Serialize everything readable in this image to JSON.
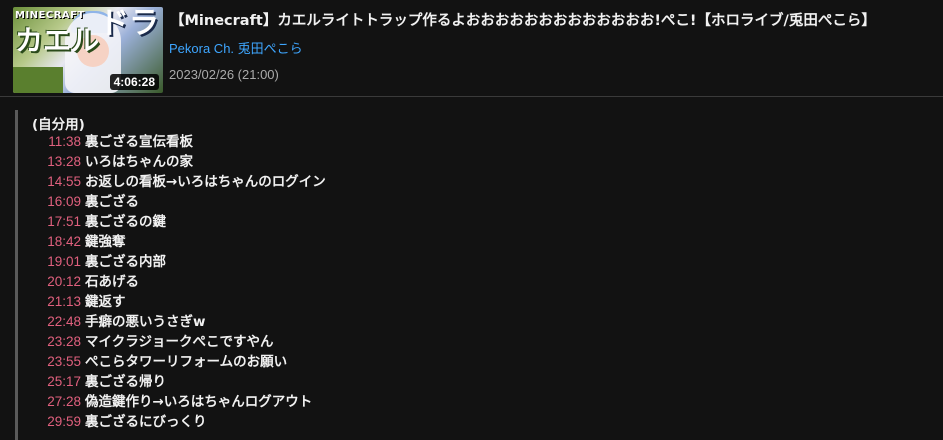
{
  "video": {
    "title": "【Minecraft】カエルライトトラップ作るよおおおおおおおおおおおおお!ぺこ!【ホロライブ/兎田ぺこら】",
    "channel": "Pekora Ch. 兎田ぺこら",
    "date": "2023/02/26 (21:00)",
    "duration": "4:06:28",
    "thumbnail_text": {
      "minecraft": "MINECRAFT",
      "left": "カエル",
      "right": "ドラ"
    }
  },
  "comment": {
    "heading": "(自分用)",
    "timestamps": [
      {
        "time": "11:38",
        "text": "裏ござる宣伝看板"
      },
      {
        "time": "13:28",
        "text": "いろはちゃんの家"
      },
      {
        "time": "14:55",
        "text": "お返しの看板→いろはちゃんのログイン"
      },
      {
        "time": "16:09",
        "text": "裏ござる"
      },
      {
        "time": "17:51",
        "text": "裏ござるの鍵"
      },
      {
        "time": "18:42",
        "text": "鍵強奪"
      },
      {
        "time": "19:01",
        "text": "裏ござる内部"
      },
      {
        "time": "20:12",
        "text": "石あげる"
      },
      {
        "time": "21:13",
        "text": "鍵返す"
      },
      {
        "time": "22:48",
        "text": "手癖の悪いうさぎw"
      },
      {
        "time": "23:28",
        "text": "マイクラジョークぺこですやん"
      },
      {
        "time": "23:55",
        "text": "ぺこらタワーリフォームのお願い"
      },
      {
        "time": "25:17",
        "text": "裏ござる帰り"
      },
      {
        "time": "27:28",
        "text": "偽造鍵作り→いろはちゃんログアウト"
      },
      {
        "time": "29:59",
        "text": "裏ござるにびっくり"
      }
    ]
  },
  "colors": {
    "background": "#121212",
    "timestamp": "#e0607e",
    "channel_link": "#3ea6ff",
    "meta_text": "#aaaaaa"
  }
}
